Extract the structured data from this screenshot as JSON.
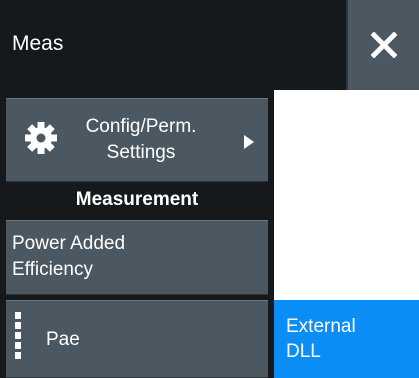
{
  "header": {
    "title": "Meas",
    "close_icon": "close-icon"
  },
  "config_button": {
    "label": "Config/Perm. Settings",
    "line1": "Config/Perm.",
    "line2": "Settings",
    "icon": "gear-icon",
    "arrow_icon": "triangle-right-icon"
  },
  "section": {
    "label": "Measurement"
  },
  "function_button": {
    "line1": "Power Added",
    "line2": "Efficiency"
  },
  "pae_button": {
    "label": "Pae",
    "icon": "softkey-dots-icon"
  },
  "external_dll": {
    "line1": "External",
    "line2": "DLL"
  },
  "colors": {
    "background": "#16191c",
    "button": "#4b5862",
    "accent": "#0a8ef5",
    "text": "#ffffff"
  }
}
